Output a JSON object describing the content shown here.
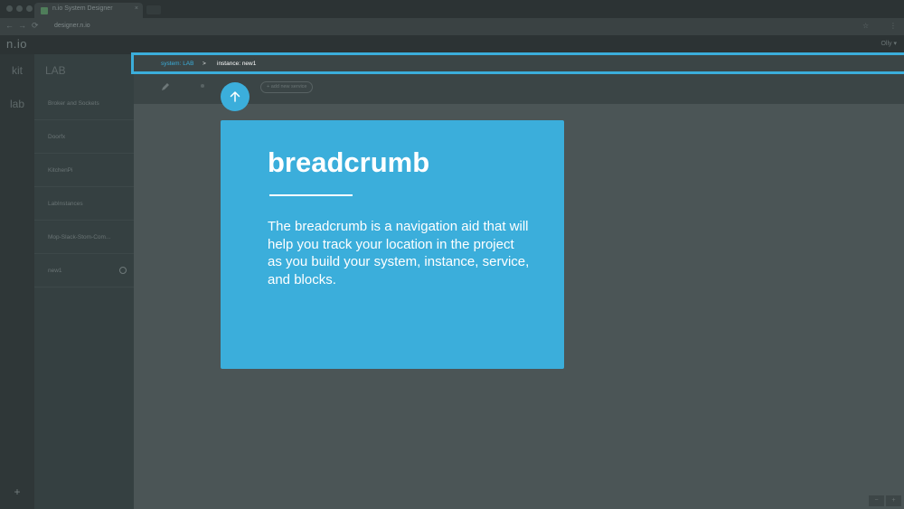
{
  "browser": {
    "tab_title": "n.io System Designer",
    "tab_close": "×",
    "url": "designer.n.io",
    "back_glyph": "←",
    "forward_glyph": "→",
    "reload_glyph": "⟳",
    "star_glyph": "☆",
    "menu_glyph": "⋮"
  },
  "app": {
    "logo": "n.io",
    "user": "Olly ▾"
  },
  "rail": {
    "items": [
      "kit",
      "lab"
    ],
    "add": "+"
  },
  "panel": {
    "title": "LAB",
    "items": [
      "Broker and Sockets",
      "Doorfx",
      "KitchenPi",
      "LabInstances",
      "Mop-Slack-Stom-Com...",
      "new1"
    ]
  },
  "toolbar": {
    "add_service": "+ add new service"
  },
  "breadcrumb": {
    "system": "system: LAB",
    "separator": ">",
    "instance": "instance: new1"
  },
  "zoom": {
    "out": "−",
    "in": "+"
  },
  "tip": {
    "title": "breadcrumb",
    "body": "The breadcrumb is a navigation aid that will help you track your location in the project as you build your system, instance, service, and blocks."
  },
  "colors": {
    "accent": "#3baedb",
    "canvas": "#4b5556",
    "panel": "#354041",
    "rail": "#2f3738"
  }
}
